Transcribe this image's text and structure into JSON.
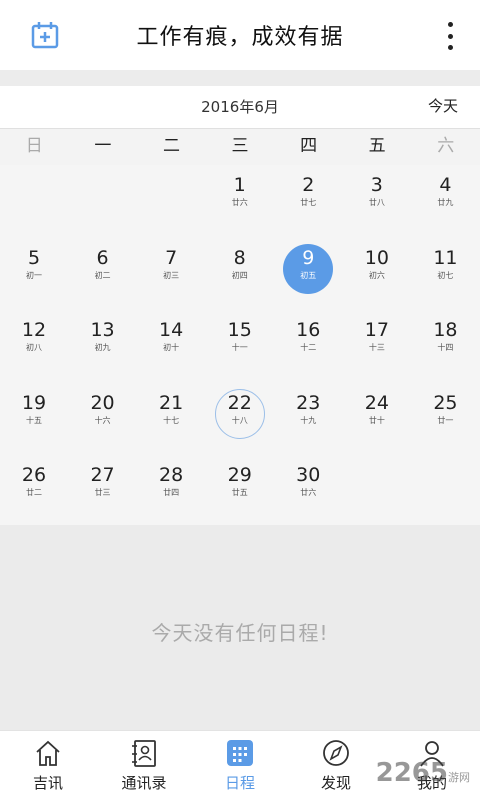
{
  "header": {
    "title": "工作有痕，成效有据",
    "left_icon": "calendar-add-icon",
    "right_icon": "more-vertical-icon"
  },
  "calendar": {
    "month_label": "2016年6月",
    "today_button": "今天",
    "weekdays": [
      "日",
      "一",
      "二",
      "三",
      "四",
      "五",
      "六"
    ],
    "selected_day": "9",
    "today_day": "22",
    "accent_color": "#5b9be6",
    "days": [
      {
        "num": "1",
        "lunar": "廿六"
      },
      {
        "num": "2",
        "lunar": "廿七"
      },
      {
        "num": "3",
        "lunar": "廿八"
      },
      {
        "num": "4",
        "lunar": "廿九"
      },
      {
        "num": "5",
        "lunar": "初一"
      },
      {
        "num": "6",
        "lunar": "初二"
      },
      {
        "num": "7",
        "lunar": "初三"
      },
      {
        "num": "8",
        "lunar": "初四"
      },
      {
        "num": "9",
        "lunar": "初五"
      },
      {
        "num": "10",
        "lunar": "初六"
      },
      {
        "num": "11",
        "lunar": "初七"
      },
      {
        "num": "12",
        "lunar": "初八"
      },
      {
        "num": "13",
        "lunar": "初九"
      },
      {
        "num": "14",
        "lunar": "初十"
      },
      {
        "num": "15",
        "lunar": "十一"
      },
      {
        "num": "16",
        "lunar": "十二"
      },
      {
        "num": "17",
        "lunar": "十三"
      },
      {
        "num": "18",
        "lunar": "十四"
      },
      {
        "num": "19",
        "lunar": "十五"
      },
      {
        "num": "20",
        "lunar": "十六"
      },
      {
        "num": "21",
        "lunar": "十七"
      },
      {
        "num": "22",
        "lunar": "十八"
      },
      {
        "num": "23",
        "lunar": "十九"
      },
      {
        "num": "24",
        "lunar": "廿十"
      },
      {
        "num": "25",
        "lunar": "廿一"
      },
      {
        "num": "26",
        "lunar": "廿二"
      },
      {
        "num": "27",
        "lunar": "廿三"
      },
      {
        "num": "28",
        "lunar": "廿四"
      },
      {
        "num": "29",
        "lunar": "廿五"
      },
      {
        "num": "30",
        "lunar": "廿六"
      }
    ]
  },
  "empty_message": "今天没有任何日程!",
  "tabs": [
    {
      "label": "吉讯",
      "icon": "home-icon"
    },
    {
      "label": "通讯录",
      "icon": "contacts-icon"
    },
    {
      "label": "日程",
      "icon": "calendar-grid-icon",
      "active": true
    },
    {
      "label": "发现",
      "icon": "compass-icon"
    },
    {
      "label": "我的",
      "icon": "person-icon"
    }
  ],
  "watermark": {
    "text": "2265",
    "sub": "游网"
  }
}
